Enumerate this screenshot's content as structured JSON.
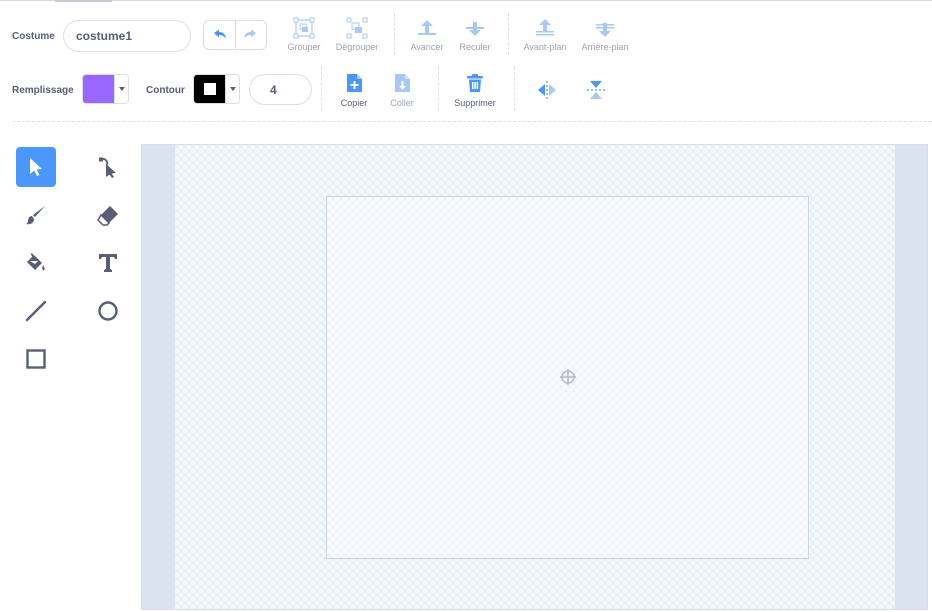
{
  "costume": {
    "label": "Costume",
    "name_value": "costume1"
  },
  "toolbar": {
    "undo_icon": "undo-icon",
    "redo_icon": "redo-icon",
    "group_label": "Grouper",
    "ungroup_label": "Dégrouper",
    "forward_label": "Avancer",
    "backward_label": "Reculer",
    "front_label": "Avant-plan",
    "back_label": "Arrière-plan"
  },
  "fill": {
    "label": "Remplissage",
    "color": "#9966ff"
  },
  "outline": {
    "label": "Contour",
    "color": "#000000",
    "width_value": "4"
  },
  "edit": {
    "copy_label": "Copier",
    "paste_label": "Coller",
    "delete_label": "Supprimer",
    "flip_h_icon": "flip-horizontal-icon",
    "flip_v_icon": "flip-vertical-icon"
  },
  "tools": [
    {
      "name": "select",
      "icon": "select-arrow-icon",
      "selected": true
    },
    {
      "name": "reshape",
      "icon": "reshape-icon",
      "selected": false
    },
    {
      "name": "brush",
      "icon": "brush-icon",
      "selected": false
    },
    {
      "name": "eraser",
      "icon": "eraser-icon",
      "selected": false
    },
    {
      "name": "fill",
      "icon": "fill-bucket-icon",
      "selected": false
    },
    {
      "name": "text",
      "icon": "text-icon",
      "selected": false
    },
    {
      "name": "line",
      "icon": "line-icon",
      "selected": false
    },
    {
      "name": "circle",
      "icon": "circle-icon",
      "selected": false
    },
    {
      "name": "rectangle",
      "icon": "rectangle-icon",
      "selected": false
    }
  ],
  "colors": {
    "accent": "#4c97ff",
    "text": "#575e75",
    "disabled": "#9aa3b8"
  }
}
